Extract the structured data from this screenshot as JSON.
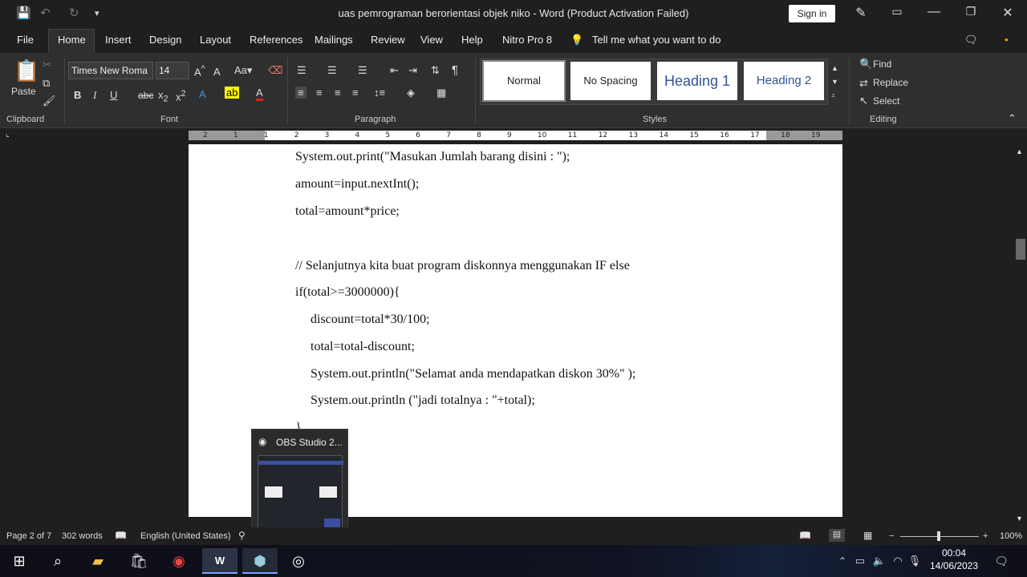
{
  "titlebar": {
    "doc_title": "uas pemrograman berorientasi objek niko  -  Word (Product Activation Failed)",
    "sign_in": "Sign in",
    "qat_save": "💾",
    "qat_undo": "↶",
    "qat_redo": "↻",
    "qat_more": "▾"
  },
  "tabs": [
    "File",
    "Home",
    "Insert",
    "Design",
    "Layout",
    "References",
    "Mailings",
    "Review",
    "View",
    "Help",
    "Nitro Pro 8"
  ],
  "tell_me": "Tell me what you want to do",
  "ribbon": {
    "paste_label": "Paste",
    "font_name": "Times New Roma",
    "font_size": "14",
    "styles": [
      "Normal",
      "No Spacing",
      "Heading 1",
      "Heading 2"
    ],
    "find": "Find",
    "replace": "Replace",
    "select": "Select",
    "groups": {
      "clipboard": "Clipboard",
      "font": "Font",
      "paragraph": "Paragraph",
      "styles": "Styles",
      "editing": "Editing"
    }
  },
  "ruler_ticks": [
    "2",
    "1",
    "1",
    "2",
    "3",
    "4",
    "5",
    "6",
    "7",
    "8",
    "9",
    "10",
    "11",
    "12",
    "13",
    "14",
    "15",
    "16",
    "17",
    "18",
    "19"
  ],
  "document": {
    "lines": [
      "System.out.print(\"Masukan Jumlah barang disini : \");",
      "amount=input.nextInt();",
      "total=amount*price;",
      "",
      "// Selanjutnya kita buat program diskonnya menggunakan IF else",
      "if(total>=3000000){",
      "discount=total*30/100;",
      "total=total-discount;",
      "System.out.println(\"Selamat anda mendapatkan diskon 30%\" );",
      "System.out.println (\"jadi totalnya : \"+total);",
      "}"
    ]
  },
  "thumbnail": {
    "title": "OBS Studio 2..."
  },
  "status": {
    "page": "Page 2 of 7",
    "words": "302 words",
    "language": "English (United States)",
    "zoom": "100%"
  },
  "taskbar": {
    "time": "00:04",
    "date": "14/06/2023"
  },
  "colors": {
    "accent": "#185abd",
    "ribbon_bg": "#2f2f2f",
    "title_bg": "#1f1f1f"
  }
}
